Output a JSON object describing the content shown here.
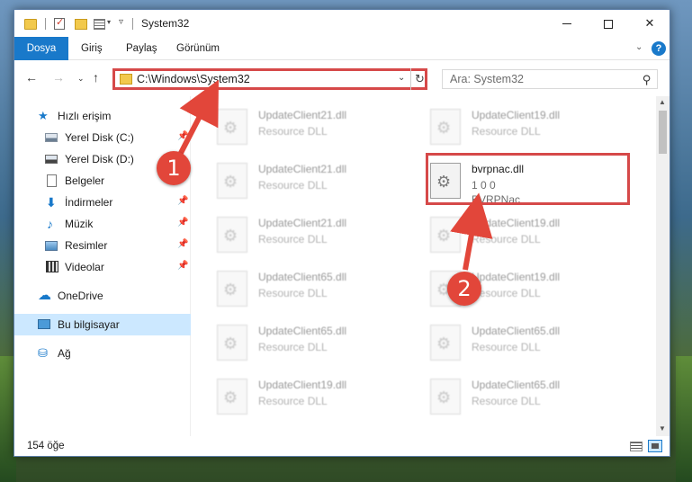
{
  "window": {
    "title": "System32",
    "buttons": {
      "minimize": "minimize",
      "maximize": "maximize",
      "close": "✕"
    }
  },
  "ribbon": {
    "tabs": [
      "Dosya",
      "Giriş",
      "Paylaş",
      "Görünüm"
    ],
    "expand": "⌄",
    "help": "?"
  },
  "nav": {
    "back": "←",
    "forward": "→",
    "recent": "⌄",
    "up": "↑",
    "address": "C:\\Windows\\System32",
    "address_dropdown": "⌄",
    "refresh": "↻"
  },
  "search": {
    "placeholder": "Ara: System32"
  },
  "sidebar": {
    "items": [
      {
        "label": "Hızlı erişim",
        "icon": "star-icon"
      },
      {
        "label": "Yerel Disk (C:)",
        "icon": "drive-icon",
        "pinned": true
      },
      {
        "label": "Yerel Disk (D:)",
        "icon": "drive-icon"
      },
      {
        "label": "Belgeler",
        "icon": "document-icon"
      },
      {
        "label": "İndirmeler",
        "icon": "download-icon",
        "pinned": true
      },
      {
        "label": "Müzik",
        "icon": "music-icon",
        "pinned": true
      },
      {
        "label": "Resimler",
        "icon": "pictures-icon",
        "pinned": true
      },
      {
        "label": "Videolar",
        "icon": "video-icon",
        "pinned": true
      },
      {
        "label": "OneDrive",
        "icon": "cloud-icon"
      },
      {
        "label": "Bu bilgisayar",
        "icon": "computer-icon",
        "selected": true
      },
      {
        "label": "Ağ",
        "icon": "network-icon"
      }
    ]
  },
  "files": {
    "left_column": [
      {
        "name": "UpdateClient21.dll",
        "desc": "Resource DLL"
      },
      {
        "name": "UpdateClient21.dll",
        "desc": "Resource DLL"
      },
      {
        "name": "UpdateClient21.dll",
        "desc": "Resource DLL"
      },
      {
        "name": "UpdateClient65.dll",
        "desc": "Resource DLL"
      },
      {
        "name": "UpdateClient65.dll",
        "desc": "Resource DLL"
      },
      {
        "name": "UpdateClient19.dll",
        "desc": "Resource DLL"
      }
    ],
    "right_column": [
      {
        "name": "UpdateClient19.dll",
        "desc": "Resource DLL"
      },
      {
        "name": "bvrpnac.dll",
        "desc": "1 0 0",
        "desc2": "BVRPNac",
        "focused": true
      },
      {
        "name": "UpdateClient19.dll",
        "desc": "Resource DLL"
      },
      {
        "name": "UpdateClient19.dll",
        "desc": "Resource DLL"
      },
      {
        "name": "UpdateClient65.dll",
        "desc": "Resource DLL"
      },
      {
        "name": "UpdateClient65.dll",
        "desc": "Resource DLL"
      }
    ]
  },
  "status": {
    "item_count": "154 öğe"
  },
  "annotations": {
    "step1": "1",
    "step2": "2"
  },
  "colors": {
    "accent": "#1979ca",
    "highlight": "#d64949",
    "callout": "#e2463a"
  }
}
